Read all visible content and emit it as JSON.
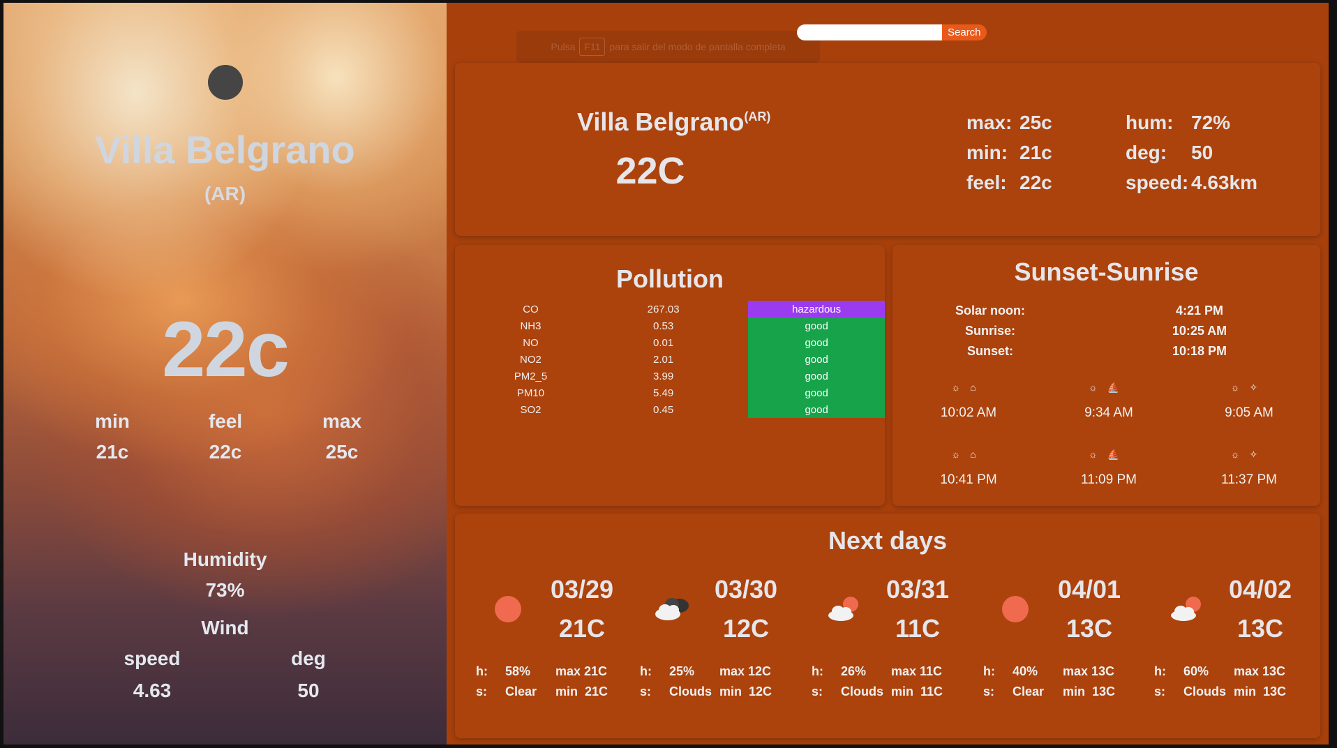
{
  "left": {
    "city": "Villa Belgrano",
    "country": "(AR)",
    "temp": "22c",
    "min_label": "min",
    "min_value": "21c",
    "feel_label": "feel",
    "feel_value": "22c",
    "max_label": "max",
    "max_value": "25c",
    "humidity_label": "Humidity",
    "humidity_value": "73%",
    "wind_label": "Wind",
    "speed_label": "speed",
    "speed_value": "4.63",
    "deg_label": "deg",
    "deg_value": "50"
  },
  "browser": {
    "fullscreen_pre": "Pulsa",
    "fullscreen_key": "F11",
    "fullscreen_post": "para salir del modo de pantalla completa"
  },
  "search": {
    "placeholder": "",
    "button": "Search"
  },
  "current": {
    "city": "Villa Belgrano",
    "country": "(AR)",
    "temp": "22C",
    "stats_left": [
      {
        "k": "max:",
        "v": "25c"
      },
      {
        "k": "min:",
        "v": "21c"
      },
      {
        "k": "feel:",
        "v": "22c"
      }
    ],
    "stats_right": [
      {
        "k": "hum:",
        "v": "72%"
      },
      {
        "k": "deg:",
        "v": "50"
      },
      {
        "k": "speed:",
        "v": "4.63km"
      }
    ]
  },
  "pollution": {
    "title": "Pollution",
    "rows": [
      {
        "name": "CO",
        "value": "267.03",
        "status": "hazardous"
      },
      {
        "name": "NH3",
        "value": "0.53",
        "status": "good"
      },
      {
        "name": "NO",
        "value": "0.01",
        "status": "good"
      },
      {
        "name": "NO2",
        "value": "2.01",
        "status": "good"
      },
      {
        "name": "PM2_5",
        "value": "3.99",
        "status": "good"
      },
      {
        "name": "PM10",
        "value": "5.49",
        "status": "good"
      },
      {
        "name": "SO2",
        "value": "0.45",
        "status": "good"
      }
    ],
    "colors": {
      "hazardous": "#9b3bf0",
      "good": "#16a34a"
    }
  },
  "sun": {
    "title": "Sunset-Sunrise",
    "rows": [
      {
        "k": "Solar noon:",
        "v": "4:21 PM"
      },
      {
        "k": "Sunrise:",
        "v": "10:25 AM"
      },
      {
        "k": "Sunset:",
        "v": "10:18 PM"
      }
    ],
    "twilight_morning": [
      "10:02 AM",
      "9:34 AM",
      "9:05 AM"
    ],
    "twilight_evening": [
      "10:41 PM",
      "11:09 PM",
      "11:37 PM"
    ]
  },
  "next": {
    "title": "Next days",
    "days": [
      {
        "date": "03/29",
        "temp": "21C",
        "icon": "sun-icon",
        "h_label": "h:",
        "h": "58%",
        "s_label": "s:",
        "s": "Clear",
        "max": "max 21C",
        "min": "min  21C"
      },
      {
        "date": "03/30",
        "temp": "12C",
        "icon": "dark-clouds-icon",
        "h_label": "h:",
        "h": "25%",
        "s_label": "s:",
        "s": "Clouds",
        "max": "max 12C",
        "min": "min  12C"
      },
      {
        "date": "03/31",
        "temp": "11C",
        "icon": "sun-cloud-icon",
        "h_label": "h:",
        "h": "26%",
        "s_label": "s:",
        "s": "Clouds",
        "max": "max 11C",
        "min": "min  11C"
      },
      {
        "date": "04/01",
        "temp": "13C",
        "icon": "sun-icon",
        "h_label": "h:",
        "h": "40%",
        "s_label": "s:",
        "s": "Clear",
        "max": "max 13C",
        "min": "min  13C"
      },
      {
        "date": "04/02",
        "temp": "13C",
        "icon": "sun-cloud-icon",
        "h_label": "h:",
        "h": "60%",
        "s_label": "s:",
        "s": "Clouds",
        "max": "max 13C",
        "min": "min  13C"
      }
    ]
  }
}
